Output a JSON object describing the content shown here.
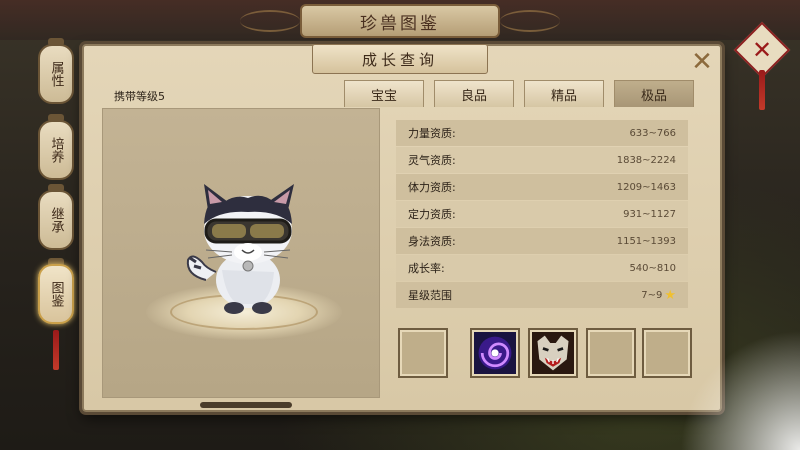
{
  "window": {
    "title": "珍兽图鉴"
  },
  "panel": {
    "header": "成长查询",
    "close_glyph": "✕"
  },
  "seal": {
    "close_glyph": "✕"
  },
  "side_tabs": [
    {
      "label": "属性",
      "active": false
    },
    {
      "label": "培养",
      "active": false
    },
    {
      "label": "继承",
      "active": false
    },
    {
      "label": "图鉴",
      "active": true
    }
  ],
  "carry_level": "携带等级5",
  "tabs": [
    {
      "label": "宝宝",
      "active": false
    },
    {
      "label": "良品",
      "active": false
    },
    {
      "label": "精品",
      "active": false
    },
    {
      "label": "极品",
      "active": true
    }
  ],
  "stats": [
    {
      "label": "力量资质:",
      "value": "633~766"
    },
    {
      "label": "灵气资质:",
      "value": "1838~2224"
    },
    {
      "label": "体力资质:",
      "value": "1209~1463"
    },
    {
      "label": "定力资质:",
      "value": "931~1127"
    },
    {
      "label": "身法资质:",
      "value": "1151~1393"
    },
    {
      "label": "成长率:",
      "value": "540~810"
    },
    {
      "label": "星级范围",
      "value": "7~9"
    }
  ],
  "skills": [
    {
      "icon": "empty-slot"
    },
    {
      "icon": "purple-vortex-skill-icon"
    },
    {
      "icon": "fierce-beast-skill-icon"
    },
    {
      "icon": "empty-slot"
    },
    {
      "icon": "empty-slot"
    }
  ],
  "colors": {
    "accent_gold": "#caa04a",
    "seal_red": "#9a1a1a",
    "parchment": "#e4d6b8"
  }
}
